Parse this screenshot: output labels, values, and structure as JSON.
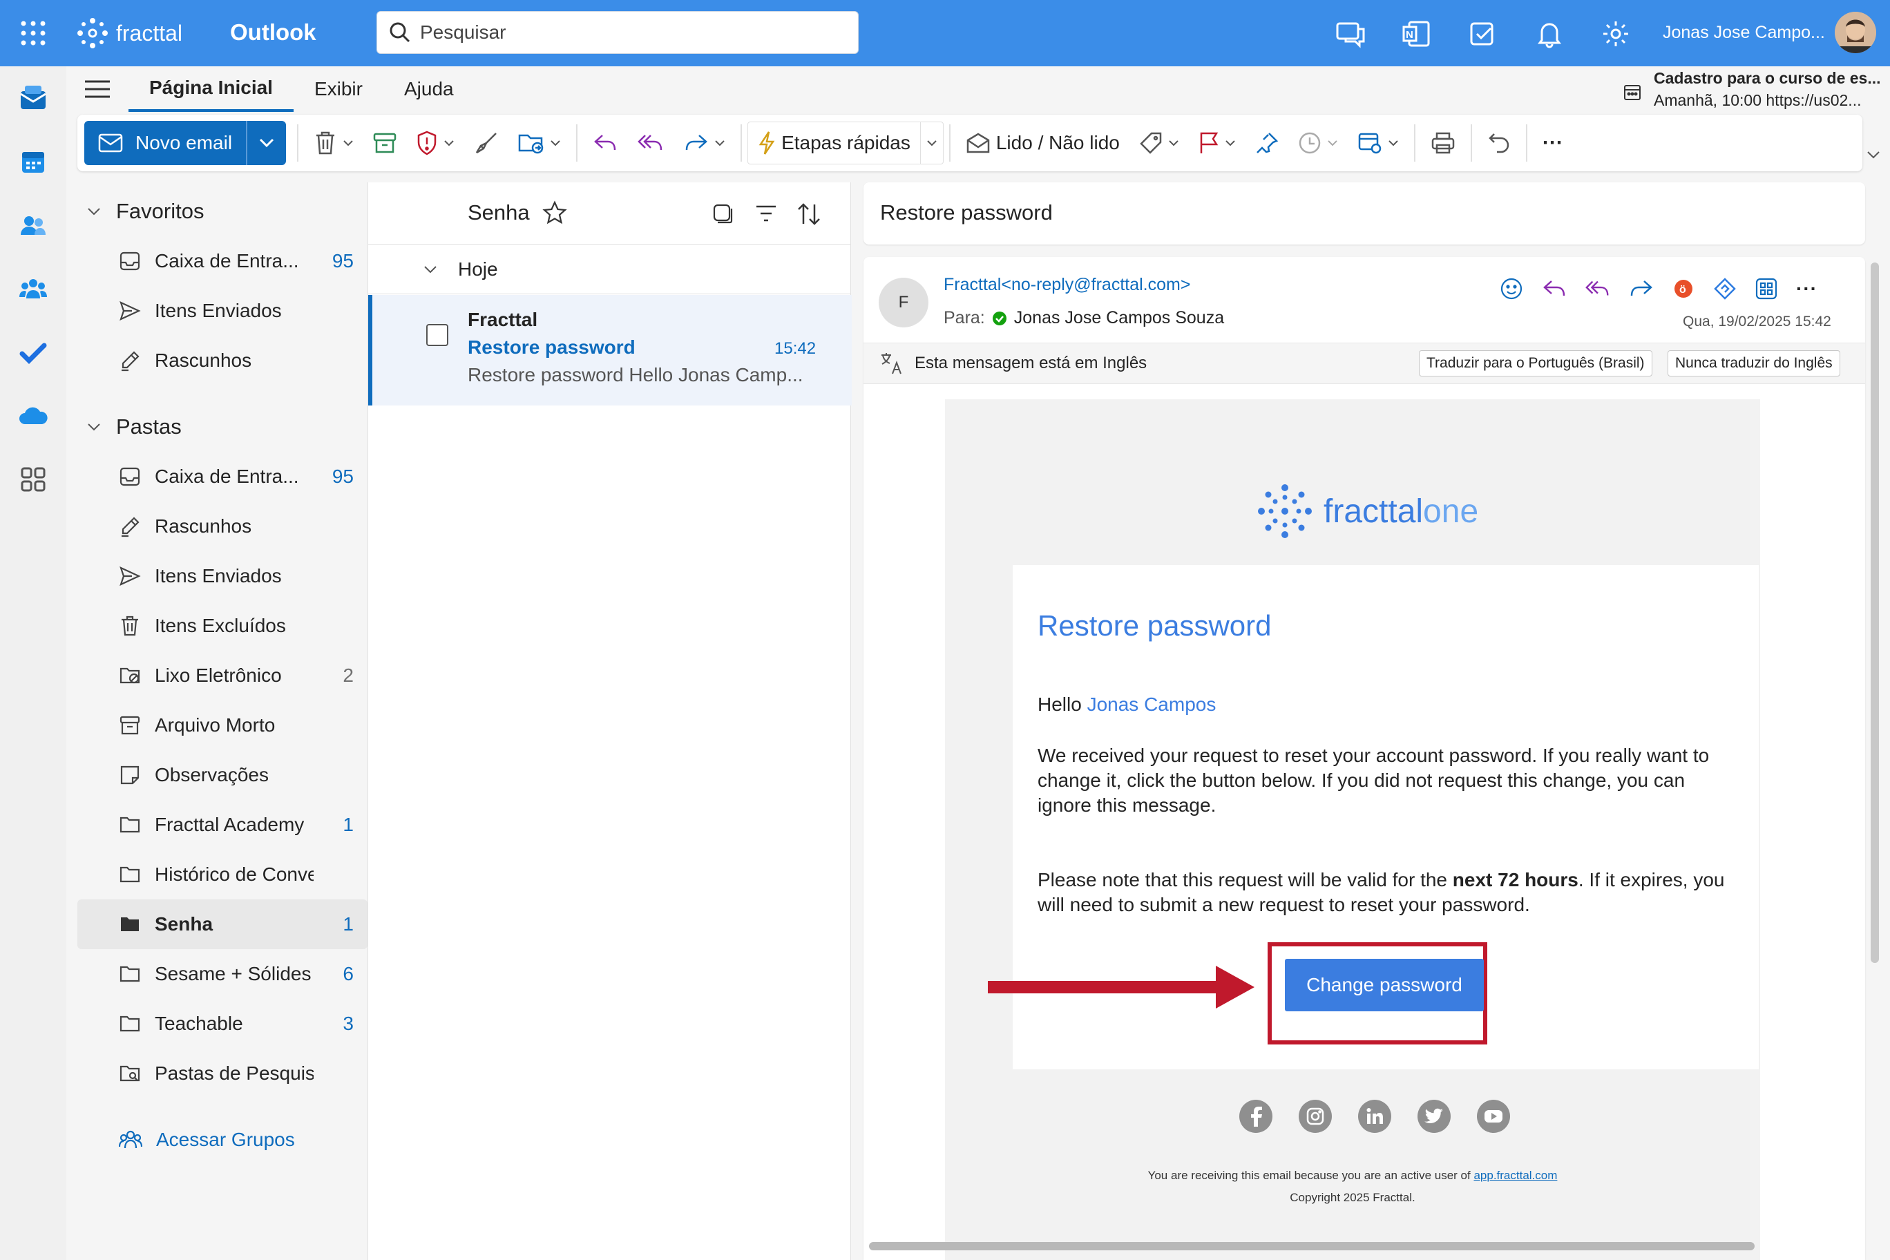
{
  "topbar": {
    "brand": "fracttal",
    "app": "Outlook",
    "search_placeholder": "Pesquisar",
    "user": "Jonas Jose Campo..."
  },
  "ribbon": {
    "tabs": [
      "Página Inicial",
      "Exibir",
      "Ajuda"
    ],
    "new_mail": "Novo email",
    "quick_steps": "Etapas rápidas",
    "read_unread": "Lido / Não lido",
    "more": "···"
  },
  "reminder": {
    "title": "Cadastro para o curso de es...",
    "subtitle": "Amanhã, 10:00 https://us02..."
  },
  "folders": {
    "favorites_label": "Favoritos",
    "favorites": [
      {
        "label": "Caixa de Entra...",
        "count": "95"
      },
      {
        "label": "Itens Enviados",
        "count": ""
      },
      {
        "label": "Rascunhos",
        "count": ""
      }
    ],
    "folders_label": "Pastas",
    "items": [
      {
        "label": "Caixa de Entra...",
        "count": "95"
      },
      {
        "label": "Rascunhos",
        "count": ""
      },
      {
        "label": "Itens Enviados",
        "count": ""
      },
      {
        "label": "Itens Excluídos",
        "count": ""
      },
      {
        "label": "Lixo Eletrônico",
        "count": "2"
      },
      {
        "label": "Arquivo Morto",
        "count": ""
      },
      {
        "label": "Observações",
        "count": ""
      },
      {
        "label": "Fracttal Academy",
        "count": "1"
      },
      {
        "label": "Histórico de Conve...",
        "count": ""
      },
      {
        "label": "Senha",
        "count": "1"
      },
      {
        "label": "Sesame + Sólides",
        "count": "6"
      },
      {
        "label": "Teachable",
        "count": "3"
      },
      {
        "label": "Pastas de Pesquisa",
        "count": ""
      }
    ],
    "groups_link": "Acessar Grupos"
  },
  "message_list": {
    "folder_title": "Senha",
    "group_label": "Hoje",
    "message": {
      "sender": "Fracttal",
      "subject": "Restore password",
      "time": "15:42",
      "preview": "Restore password Hello Jonas Camp..."
    }
  },
  "reading": {
    "subject": "Restore password",
    "sender_initial": "F",
    "from": "Fracttal<no-reply@fracttal.com>",
    "to_label": "Para:",
    "to": "Jonas Jose Campos Souza",
    "date": "Qua, 19/02/2025 15:42",
    "translate_notice": "Esta mensagem está em Inglês",
    "translate_btn": "Traduzir para o Português (Brasil)",
    "never_translate_btn": "Nunca traduzir do Inglês"
  },
  "email": {
    "logo_word1": "fracttal",
    "logo_word2": "one",
    "heading": "Restore password",
    "greeting": "Hello ",
    "greeting_name": "Jonas Campos",
    "para1": "We received your request to reset your account password. If you really want to change it, click the button below. If you did not request this change, you can ignore this message.",
    "para2_a": "Please note that this request will be valid for the ",
    "para2_bold": "next 72 hours",
    "para2_b": ". If it expires, you will need to submit a new request to reset your password.",
    "button": "Change password",
    "footer_a": "You are receiving this email because you are an active user of ",
    "footer_link": "app.fracttal.com",
    "copyright": "Copyright 2025 Fracttal."
  },
  "colors": {
    "topbar": "#3b8de8",
    "accent": "#0f6cbd",
    "email_accent": "#3b7de0",
    "highlight": "#c0192c"
  }
}
